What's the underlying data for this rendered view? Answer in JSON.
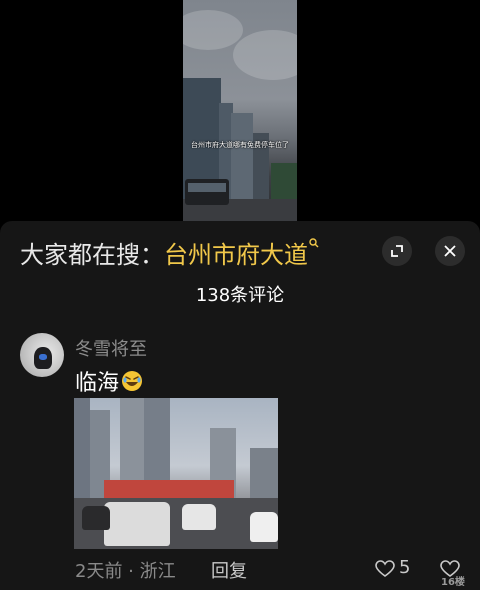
{
  "video": {
    "subtitle": "台州市府大道哪有免费停车位了"
  },
  "panel": {
    "search_prefix": "大家都在搜：",
    "search_term": "台州市府大道",
    "comment_count": "138条评论"
  },
  "comment": {
    "username": "冬雪将至",
    "text": "临海",
    "emoji": "rolling-on-floor-laughing",
    "time_location": "2天前 · 浙江",
    "reply_label": "回复",
    "like_count": "5"
  },
  "watermark": "16楼"
}
